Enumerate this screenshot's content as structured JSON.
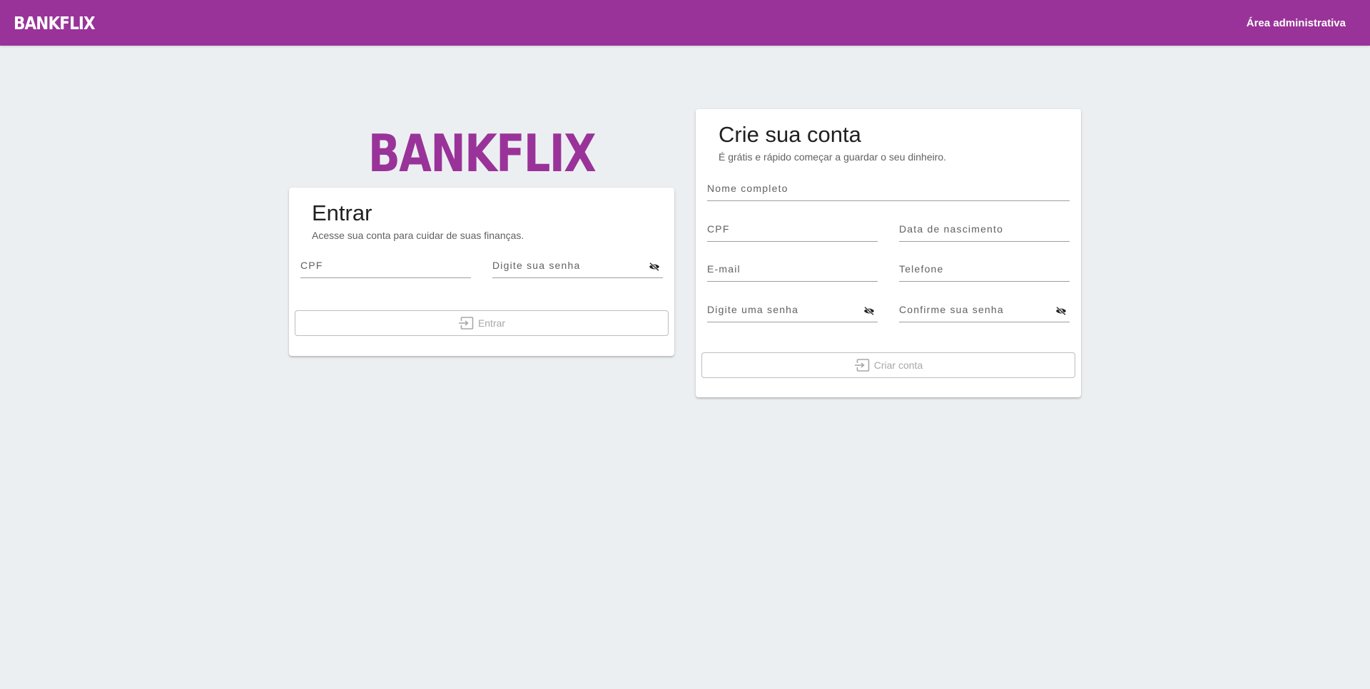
{
  "header": {
    "brand": "BANKFLIX",
    "admin_link": "Área administrativa"
  },
  "login": {
    "brand": "BANKFLIX",
    "title": "Entrar",
    "subtitle": "Acesse sua conta para cuidar de suas finanças.",
    "cpf_label": "CPF",
    "password_label": "Digite sua senha",
    "submit_label": "Entrar",
    "submit_icon": "login-icon",
    "visibility_icon": "eye-off-icon"
  },
  "signup": {
    "title": "Crie sua conta",
    "subtitle": "É grátis e rápido começar a guardar o seu dinheiro.",
    "full_name_label": "Nome completo",
    "cpf_label": "CPF",
    "birth_date_label": "Data de nascimento",
    "email_label": "E-mail",
    "phone_label": "Telefone",
    "password_label": "Digite uma senha",
    "confirm_password_label": "Confirme sua senha",
    "submit_label": "Criar conta",
    "submit_icon": "login-icon"
  },
  "colors": {
    "brand": "#993399",
    "background": "#eceff1",
    "disabled_text": "#a8a8a8"
  }
}
